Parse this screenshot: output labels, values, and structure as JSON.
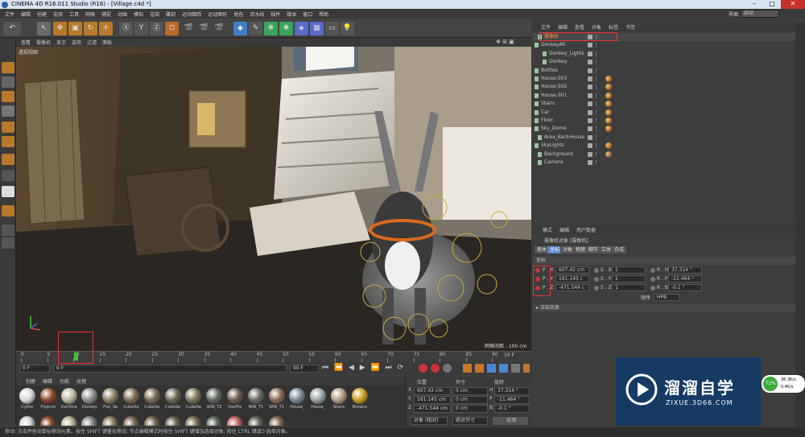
{
  "window": {
    "title": "CINEMA 4D R16.011 Studio (R16) - [Village.c4d *]"
  },
  "menubar": {
    "items": [
      "文件",
      "编辑",
      "创建",
      "选择",
      "工具",
      "网格",
      "捕捉",
      "动画",
      "模拟",
      "渲染",
      "雕刻",
      "运动跟踪",
      "运动图形",
      "角色",
      "流水线",
      "插件",
      "脚本",
      "窗口",
      "帮助"
    ],
    "layout_label": "界面:",
    "layout_value": "启动"
  },
  "viewport": {
    "menu": [
      "查看",
      "摄像机",
      "显示",
      "选项",
      "过滤",
      "面板"
    ],
    "label": "透视视图",
    "grid_info": "网格间距 : 100 cm"
  },
  "timeline": {
    "ticks": [
      "0",
      "5",
      "10",
      "15",
      "20",
      "25",
      "30",
      "35",
      "40",
      "45",
      "50",
      "55",
      "60",
      "65",
      "70",
      "75",
      "80",
      "85",
      "90"
    ],
    "end_label": "10 F",
    "frame_start": "0 F",
    "frame_cur": "0 F",
    "frame_end": "90 F",
    "frame_end2": "90 F"
  },
  "materials": {
    "menu": [
      "创建",
      "编辑",
      "功能",
      "纹理"
    ],
    "items": [
      {
        "name": "Cylinc",
        "color": "#d8d8d8"
      },
      {
        "name": "Flopruh",
        "color": "#8a4a26"
      },
      {
        "name": "IronStra",
        "color": "#bfb99d"
      },
      {
        "name": "Donkey",
        "color": "#8f8f8f"
      },
      {
        "name": "Flor_Se",
        "color": "#8e7d63"
      },
      {
        "name": "CubeSe",
        "color": "#7d6b52"
      },
      {
        "name": "CubeSe",
        "color": "#786a50"
      },
      {
        "name": "CubeSe",
        "color": "#6e6555"
      },
      {
        "name": "CubeSe",
        "color": "#807556"
      },
      {
        "name": "WW_T2",
        "color": "#5d6a5a"
      },
      {
        "name": "IronFix",
        "color": "#6a5a50"
      },
      {
        "name": "WW_T1",
        "color": "#6b6a62"
      },
      {
        "name": "WW_T1",
        "color": "#8a6b55"
      },
      {
        "name": "House_",
        "color": "#7a8a96"
      },
      {
        "name": "House_",
        "color": "#9aa6a8"
      },
      {
        "name": "Stairs",
        "color": "#b4a088"
      },
      {
        "name": "Browns",
        "color": "#c9a021"
      }
    ],
    "row2_colors": [
      "#d8d8d8",
      "#8a4a26",
      "#bfb99d",
      "#8f8f8f",
      "#8e7d63",
      "#7d6b52",
      "#786a50",
      "#6e6555",
      "#807556",
      "#5d6a5a",
      "#c86a6a",
      "#6b6a62",
      "#8a6b55"
    ]
  },
  "coords": {
    "headers": [
      "位置",
      "尺寸",
      "旋转"
    ],
    "rows": [
      {
        "axis": "X",
        "pos": "607.42 cm",
        "size": "0 cm",
        "rl": "H",
        "rot": "37.314 °"
      },
      {
        "axis": "Y",
        "pos": "161.145 cm",
        "size": "0 cm",
        "rl": "P",
        "rot": "-11.464 °"
      },
      {
        "axis": "Z",
        "pos": "-471.544 cm",
        "size": "0 cm",
        "rl": "B",
        "rot": "-0.1 °"
      }
    ],
    "mode": "对象 (相对)",
    "size_mode": "绝对尺寸",
    "apply": "应用"
  },
  "objects": {
    "menu": [
      "文件",
      "编辑",
      "查看",
      "对象",
      "标签",
      "书签"
    ],
    "items": [
      {
        "name": "摄像机",
        "indent": 10,
        "selected": true,
        "material": ""
      },
      {
        "name": "DonkeyAll",
        "indent": 6,
        "material": ""
      },
      {
        "name": "Donkey_Lights",
        "indent": 16,
        "material": ""
      },
      {
        "name": "Donkey",
        "indent": 16,
        "material": ""
      },
      {
        "name": "Bottles",
        "indent": 6,
        "material": ""
      },
      {
        "name": "House.003",
        "indent": 6,
        "material": "#b56a23"
      },
      {
        "name": "House.002",
        "indent": 6,
        "material": "#b56a23"
      },
      {
        "name": "House.001",
        "indent": 6,
        "material": "#b56a23"
      },
      {
        "name": "Stairs",
        "indent": 6,
        "material": "#b56a23"
      },
      {
        "name": "Car",
        "indent": 6,
        "material": "#b56a23"
      },
      {
        "name": "Floor",
        "indent": 6,
        "material": "#b56a23"
      },
      {
        "name": "Sky_Dome",
        "indent": 6,
        "material": "#b56a23"
      },
      {
        "name": "Area_BackHouse",
        "indent": 10,
        "material": ""
      },
      {
        "name": "SkyLights",
        "indent": 6,
        "material": "#b56a23"
      },
      {
        "name": "Background",
        "indent": 10,
        "material": "#8b6a4a"
      },
      {
        "name": "Camera",
        "indent": 10,
        "material": ""
      }
    ]
  },
  "attributes": {
    "menu": [
      "模式",
      "编辑",
      "用户数据"
    ],
    "title": "摄像机对象 [摄像机]",
    "tabs": [
      "基本",
      "坐标",
      "对象",
      "物理",
      "细节",
      "立体",
      "合成"
    ],
    "section": "坐标",
    "rows": [
      {
        "p": "P . X",
        "pv": "607.42 cm",
        "s": "S . X",
        "sv": "1",
        "r": "R . H",
        "rv": "37.314 °"
      },
      {
        "p": "P . Y",
        "pv": "161.145 c",
        "s": "S . Y",
        "sv": "1",
        "r": "R . P",
        "rv": "-11.464 °"
      },
      {
        "p": "P . Z",
        "pv": "-471.544 c",
        "s": "S . Z",
        "sv": "1",
        "r": "R . B",
        "rv": "-0.1 °"
      }
    ],
    "order_label": "顺序",
    "order_value": "HPB",
    "freeze": "▸ 冻结变换"
  },
  "status": "移动: 点击并拖动鼠标移动元素。按住 SHIFT 键量化移动; 节点编辑模式时按住 SHIFT 键增加选择对象; 按住 CTRL 键减少选择对象。",
  "watermark": {
    "title": "溜溜自学",
    "url": "ZIXUE.3D66.COM"
  },
  "network": {
    "percent": "71%",
    "up": "36.3K/s",
    "down": "0.4K/s"
  },
  "colors": {
    "accent_red": "#e33333",
    "selection_blue": "#5a86c6",
    "orange_material": "#b56a23",
    "watermark_bg": "#163a63"
  }
}
